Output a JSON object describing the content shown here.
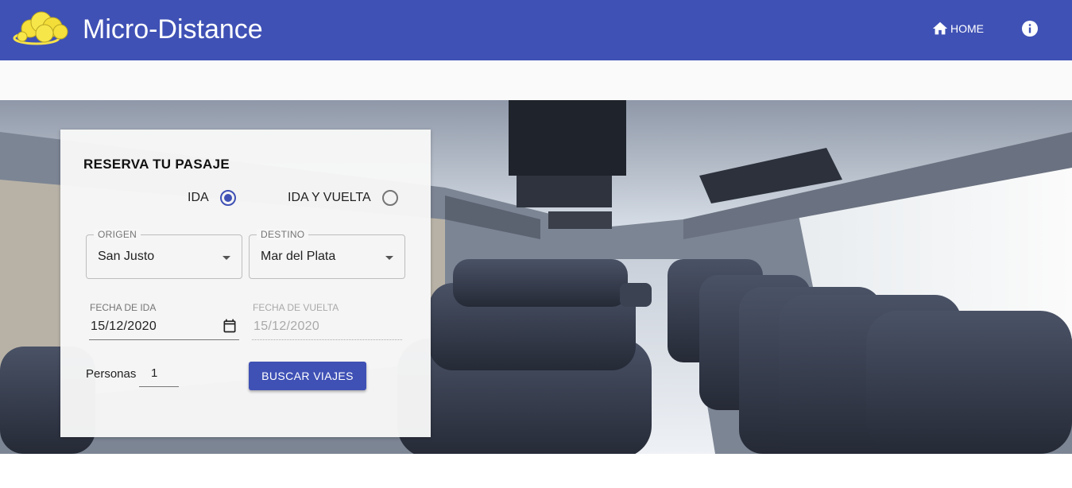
{
  "colors": {
    "primary": "#3f51b5",
    "white": "#ffffff"
  },
  "header": {
    "title": "Micro-Distance",
    "logo_icon": "cloud-logo-icon",
    "nav_home_label": "HOME",
    "home_icon": "home-icon",
    "info_icon": "info-icon"
  },
  "booking": {
    "title": "RESERVA TU PASAJE",
    "trip_type": {
      "options": [
        {
          "label": "IDA",
          "selected": true
        },
        {
          "label": "IDA Y VUELTA",
          "selected": false
        }
      ]
    },
    "origin": {
      "label": "ORIGEN",
      "value": "San Justo"
    },
    "destination": {
      "label": "DESTINO",
      "value": "Mar del Plata"
    },
    "departure_date": {
      "label": "FECHA DE IDA",
      "value": "15/12/2020"
    },
    "return_date": {
      "label": "FECHA DE VUELTA",
      "value": "15/12/2020",
      "disabled": true
    },
    "people": {
      "label": "Personas",
      "value": "1"
    },
    "search_button": "BUSCAR VIAJES"
  }
}
